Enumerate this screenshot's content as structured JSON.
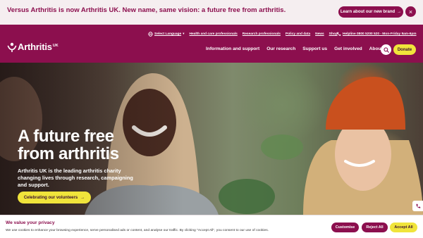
{
  "announcement": {
    "text": "Versus Arthritis is now Arthritis UK. New name, same vision: a future free from arthritis.",
    "button_label": "Learn about our new brand",
    "button_arrow": "→",
    "close_glyph": "×"
  },
  "header": {
    "logo_text": "Arthritis",
    "logo_suffix": "UK",
    "utility_links": [
      {
        "label": "Select Language"
      },
      {
        "label": "Health and care professionals"
      },
      {
        "label": "Research professionals"
      },
      {
        "label": "Policy and data"
      },
      {
        "label": "News"
      },
      {
        "label": "Shop"
      }
    ],
    "helpline": "Helpline 0800 5200 520 - Mon-Friday 9am-6pm",
    "nav": [
      {
        "label": "Information and support"
      },
      {
        "label": "Our research"
      },
      {
        "label": "Support us"
      },
      {
        "label": "Get involved"
      },
      {
        "label": "About us"
      }
    ],
    "donate_label": "Donate"
  },
  "hero": {
    "title_line1": "A future free",
    "title_line2": "from arthritis",
    "text": "Arthritis UK is the leading arthritis charity changing lives through research, campaigning and support.",
    "cta_label": "Celebrating our volunteers",
    "cta_arrow": "→"
  },
  "cookie": {
    "title": "We value your privacy",
    "text": "We use cookies to enhance your browsing experience, serve personalised ads or content, and analyse our traffic. By clicking \"Accept All\", you consent to our use of cookies.",
    "customise_label": "Customise",
    "reject_label": "Reject All",
    "accept_label": "Accept All"
  },
  "colors": {
    "brand": "#8c0f4e",
    "accent": "#f0e43b",
    "announce_bg": "#f5eef0"
  }
}
